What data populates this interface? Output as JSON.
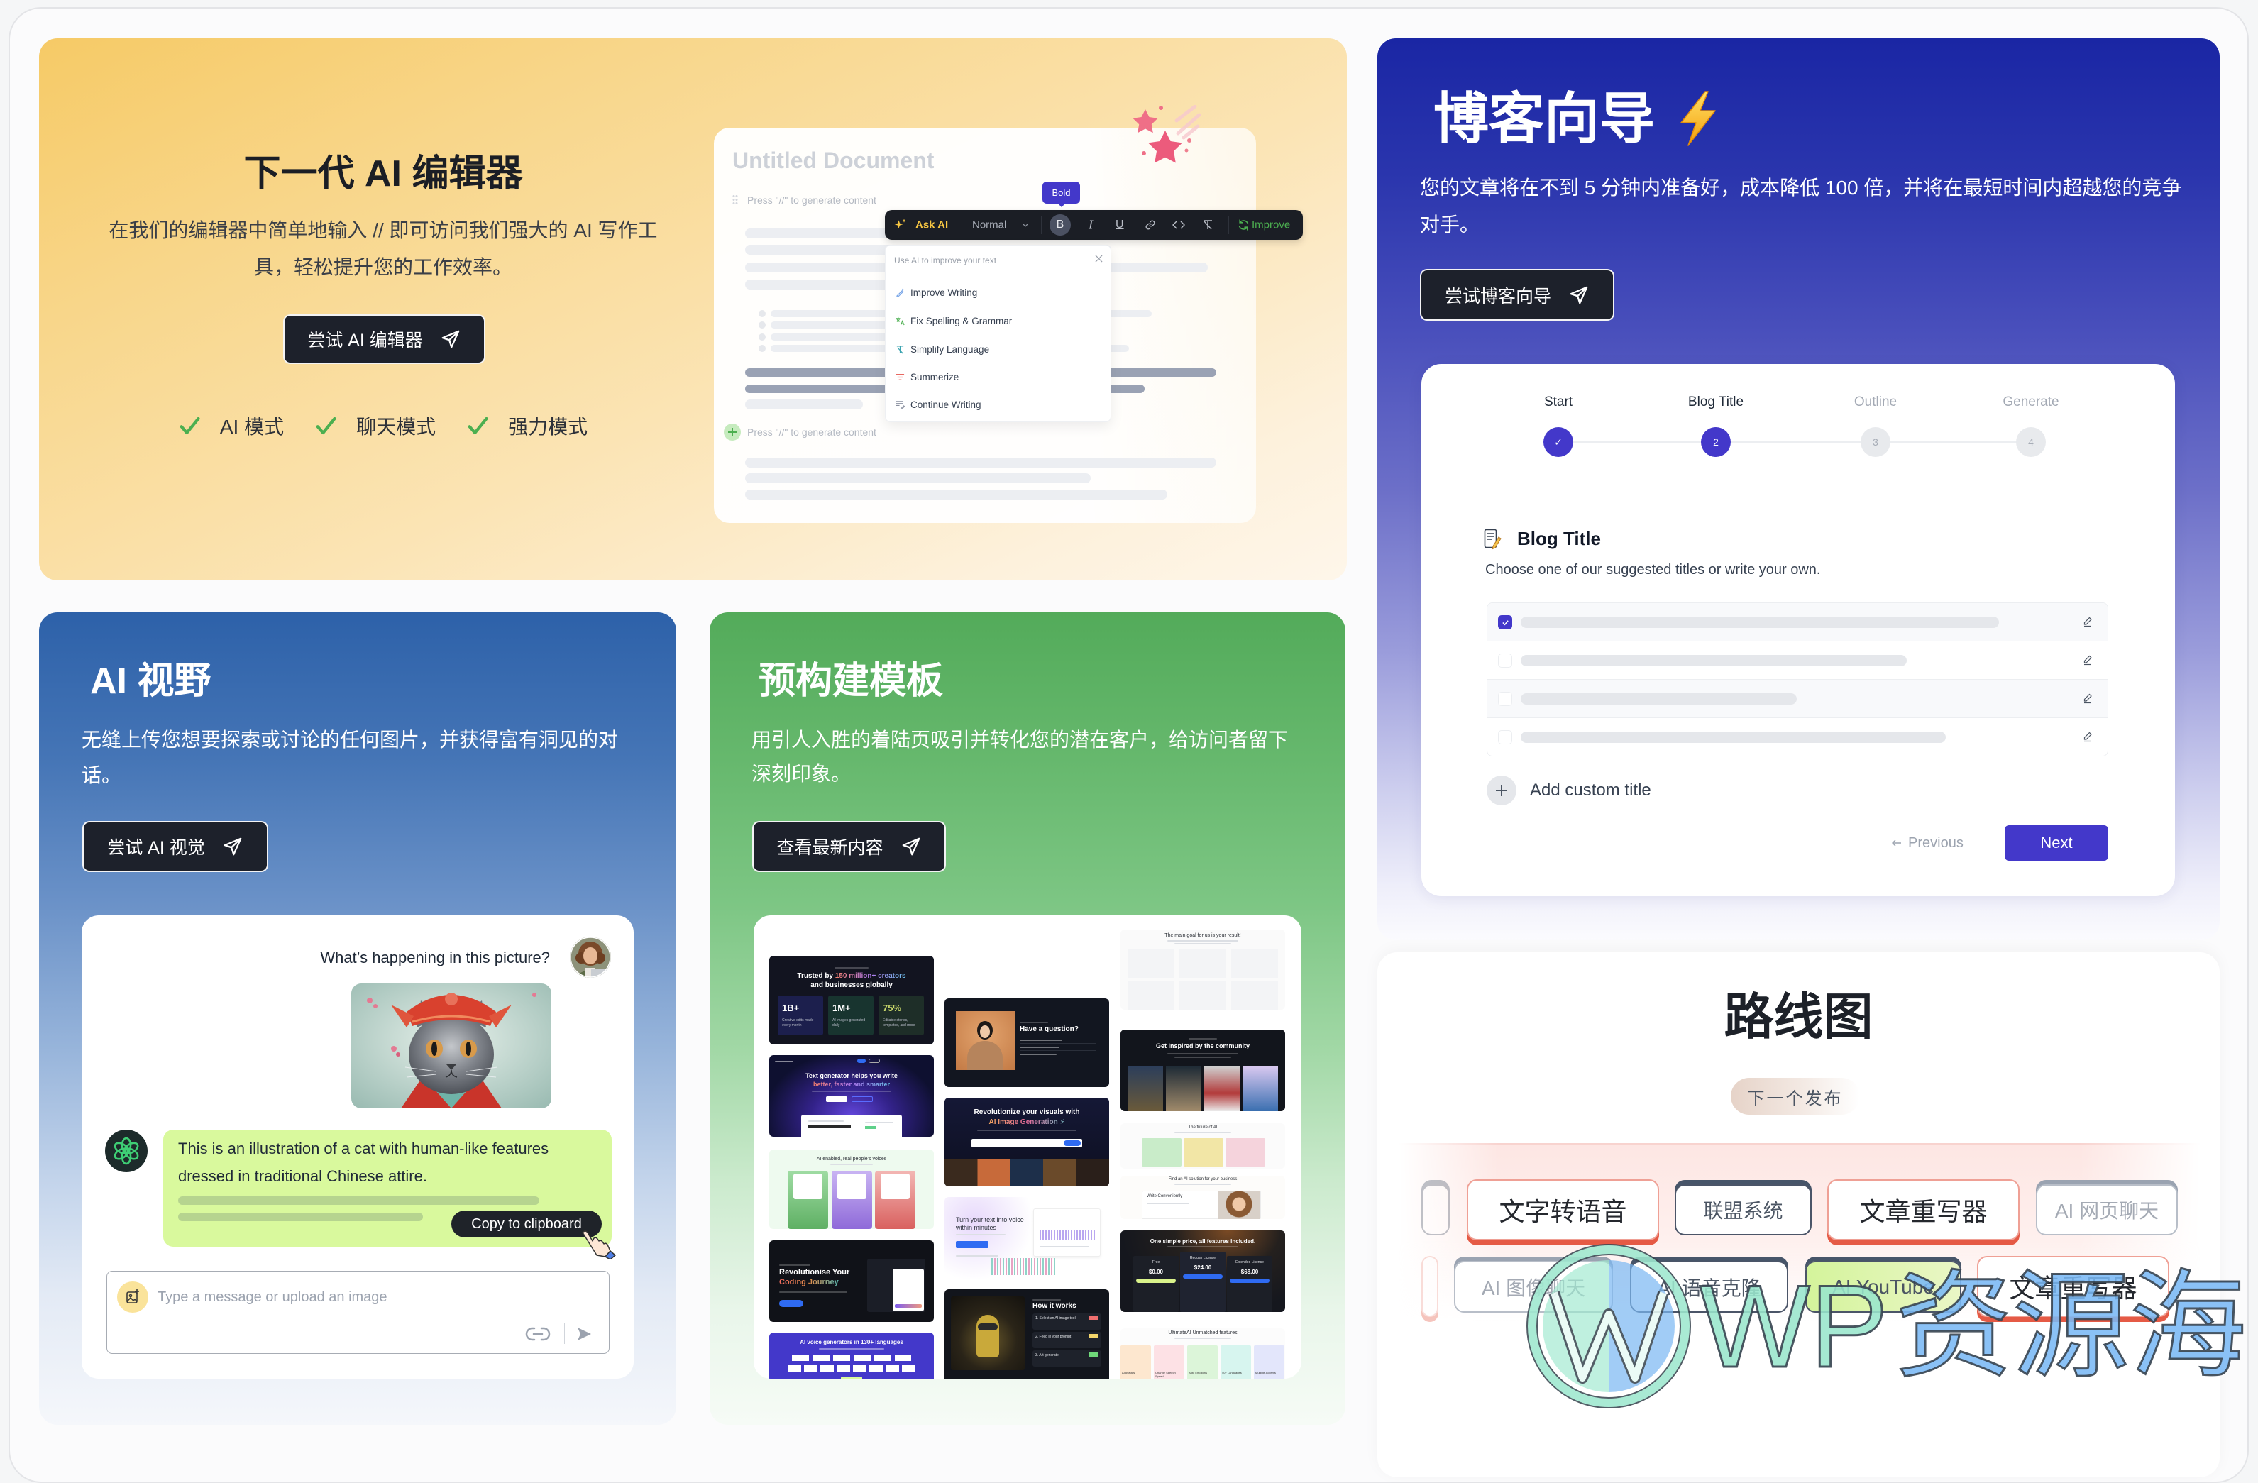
{
  "colors": {
    "accent": "#4338ca",
    "button_dark": "#1d212b",
    "check_green": "#4caf50",
    "ask_ai_yellow": "#f5c542",
    "improve_green": "#4caf50",
    "bubble_green": "#d9f99d",
    "roadmap_red": "#e55a45",
    "roadmap_slate": "#475569"
  },
  "editor_card": {
    "title": "下一代 AI 编辑器",
    "description": "在我们的编辑器中简单地输入 // 即可访问我们强大的 AI 写作工具，轻松提升您的工作效率。",
    "cta_label": "尝试 AI 编辑器",
    "cta_icon": "paper-plane-icon",
    "features": [
      {
        "label": "AI 模式",
        "icon": "check-icon"
      },
      {
        "label": "聊天模式",
        "icon": "check-icon"
      },
      {
        "label": "强力模式",
        "icon": "check-icon"
      }
    ],
    "mockup": {
      "doc_title": "Untitled Document",
      "prompt_hint": "Press \"//\" to generate content",
      "tooltip": "Bold",
      "toolbar": {
        "ask_ai": "Ask AI",
        "style_select": "Normal",
        "bold": "B",
        "italic": "I",
        "underline": "U",
        "improve": "Improve"
      },
      "ai_menu": {
        "heading": "Use AI to improve your text",
        "items": [
          {
            "label": "Improve Writing",
            "icon": "magic-wand-icon"
          },
          {
            "label": "Fix Spelling & Grammar",
            "icon": "translate-icon"
          },
          {
            "label": "Simplify Language",
            "icon": "simplify-icon"
          },
          {
            "label": "Summerize",
            "icon": "summarize-icon"
          },
          {
            "label": "Continue Writing",
            "icon": "continue-writing-icon"
          }
        ]
      }
    }
  },
  "blog_card": {
    "title": "博客向导",
    "title_icon": "lightning-icon",
    "description": "您的文章将在不到 5 分钟内准备好，成本降低 100 倍，并将在最短时间内超越您的竞争对手。",
    "cta_label": "尝试博客向导",
    "wizard": {
      "steps": [
        {
          "label": "Start",
          "marker": "✓",
          "state": "complete"
        },
        {
          "label": "Blog Title",
          "marker": "2",
          "state": "current"
        },
        {
          "label": "Outline",
          "marker": "3",
          "state": "upcoming"
        },
        {
          "label": "Generate",
          "marker": "4",
          "state": "upcoming"
        }
      ],
      "section_title": "Blog Title",
      "section_subtitle": "Choose one of our suggested titles or write your own.",
      "title_options": [
        {
          "checked": true
        },
        {
          "checked": false
        },
        {
          "checked": false
        },
        {
          "checked": false
        }
      ],
      "add_custom_label": "Add custom title",
      "previous_label": "Previous",
      "next_label": "Next"
    }
  },
  "vision_card": {
    "title": "AI 视野",
    "description": "无缝上传您想要探索或讨论的任何图片，并获得富有洞见的对话。",
    "cta_label": "尝试 AI 视觉",
    "chat": {
      "user_message": "What’s happening in this picture?",
      "ai_response": "This is an illustration of a cat with human-like features dressed in traditional Chinese attire.",
      "copy_tooltip": "Copy to clipboard",
      "input_placeholder": "Type a message or upload an image"
    }
  },
  "templates_card": {
    "title": "预构建模板",
    "description": "用引人入胜的着陆页吸引并转化您的潜在客户，给访问者留下深刻印象。",
    "cta_label": "查看最新内容",
    "previews": {
      "trusted": {
        "heading_lead": "Trusted by",
        "heading_highlight": "150 million+ creators",
        "heading_tail": "and businesses globally",
        "stats": [
          {
            "value": "1B+",
            "caption": "Creative edits made every month"
          },
          {
            "value": "1M+",
            "caption": "AI images generated daily"
          },
          {
            "value": "75%",
            "caption": "Editable stories, templates, and more"
          }
        ]
      },
      "text_generator": {
        "heading": "Text generator helps you write",
        "highlight": "better, faster and smarter"
      },
      "voices": {
        "heading": "AI enabled, real people's voices"
      },
      "coding": {
        "heading": "Revolutionise Your",
        "highlight": "Coding Journey"
      },
      "languages": {
        "heading": "AI voice generators in 130+ languages"
      },
      "faq": {
        "heading": "Have a question?"
      },
      "image_generation": {
        "heading": "Revolutionize your visuals with",
        "highlight": "AI Image Generation ⚡"
      },
      "text_to_voice": {
        "heading": "Turn your text into voice within minutes"
      },
      "how_it_works": {
        "heading": "How it works",
        "steps": [
          "1. Select an AI image tool",
          "2. Feed in your prompt",
          "3. Art generate"
        ]
      },
      "main_goal": {
        "heading": "The main goal for us is your result!"
      },
      "community": {
        "heading": "Get inspired by the community"
      },
      "future": {
        "heading": "The future of AI"
      },
      "solution": {
        "heading": "Find an AI solution for your business",
        "card_title": "Write Conveniently"
      },
      "pricing": {
        "heading": "One simple price, all features included.",
        "plans": [
          {
            "name": "Free",
            "price": "$0.00"
          },
          {
            "name": "Regular License",
            "price": "$24.00"
          },
          {
            "name": "Extended License",
            "price": "$68.00"
          }
        ]
      },
      "features": {
        "heading": "UltimateAI Unmatched features",
        "items": [
          "AI Avatars",
          "Change Speech Speed",
          "Auto Emotions",
          "40+ Languages",
          "Multiple Accents"
        ]
      }
    }
  },
  "roadmap": {
    "title": "路线图",
    "badge": "下一个发布",
    "row1": [
      {
        "label": "文字转语音",
        "style": "red"
      },
      {
        "label": "联盟系统",
        "style": "slate"
      },
      {
        "label": "文章重写器",
        "style": "red"
      },
      {
        "label": "AI 网页聊天",
        "style": "slate"
      }
    ],
    "row2": [
      {
        "label": "AI 图像聊天",
        "style": "slate"
      },
      {
        "label": "AI 语音克隆",
        "style": "slate"
      },
      {
        "label": "AI YouTube",
        "style": "green"
      },
      {
        "label": "文章重写器",
        "style": "red"
      }
    ]
  },
  "watermark": {
    "brand": "WP",
    "name": "资源海"
  }
}
